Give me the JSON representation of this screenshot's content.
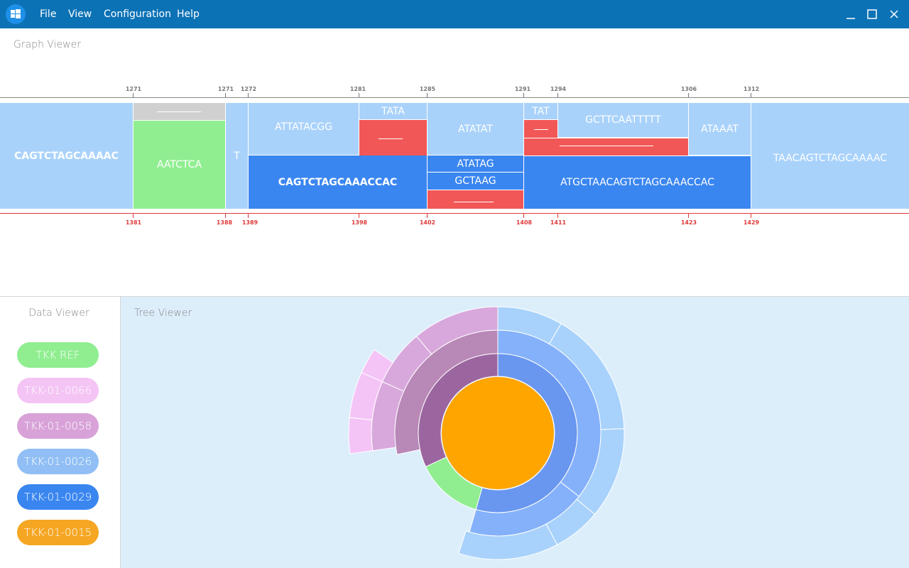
{
  "menu": {
    "file": "File",
    "view": "View",
    "configuration": "Configuration",
    "help": "Help"
  },
  "graph": {
    "title": "Graph Viewer",
    "segments": {
      "s1": "CAGTCTAGCAAAAC",
      "s3": "AATCTCA",
      "s4": "T",
      "s5": "ATTATACGG",
      "s6": "CAGTCTAGCAAACCAC",
      "s7": "TATA",
      "s9": "ATATAT",
      "s10": "ATATAG",
      "s11": "GCTAAG",
      "s13": "TAT",
      "s15": "GCTTCAATTTTT",
      "s17": "ATGCTAACAGTCTAGCAAACCAC",
      "s18": "ATAAAT",
      "s19": "TAACAGTCTAGCAAAAC"
    },
    "ref_ticks": [
      "1271",
      "1271",
      "1272",
      "1281",
      "1285",
      "1291",
      "1294",
      "1306",
      "1312"
    ],
    "alt_ticks": [
      "1381",
      "1388",
      "1389",
      "1398",
      "1402",
      "1408",
      "1411",
      "1423",
      "1429"
    ]
  },
  "data_viewer": {
    "title": "Data Viewer",
    "items": [
      {
        "label": "TKK REF",
        "color": "#90ee90"
      },
      {
        "label": "TKK-01-0066",
        "color": "#f4c4f4"
      },
      {
        "label": "TKK-01-0058",
        "color": "#d8a2d8"
      },
      {
        "label": "TKK-01-0026",
        "color": "#91bff5"
      },
      {
        "label": "TKK-01-0029",
        "color": "#3a86f0"
      },
      {
        "label": "TKK-01-0015",
        "color": "#f5a623"
      }
    ]
  },
  "tree_viewer": {
    "title": "Tree Viewer",
    "colors": {
      "center": "#ffa500",
      "green": "#90ee90",
      "blue_dark": "#6996ef",
      "blue_mid": "#85b1fb",
      "blue_light": "#a8d2fb",
      "purple_dark": "#9b669f",
      "purple_mid": "#b888b7",
      "purple_light": "#d8a8dc",
      "pink": "#f4c4f6"
    }
  }
}
